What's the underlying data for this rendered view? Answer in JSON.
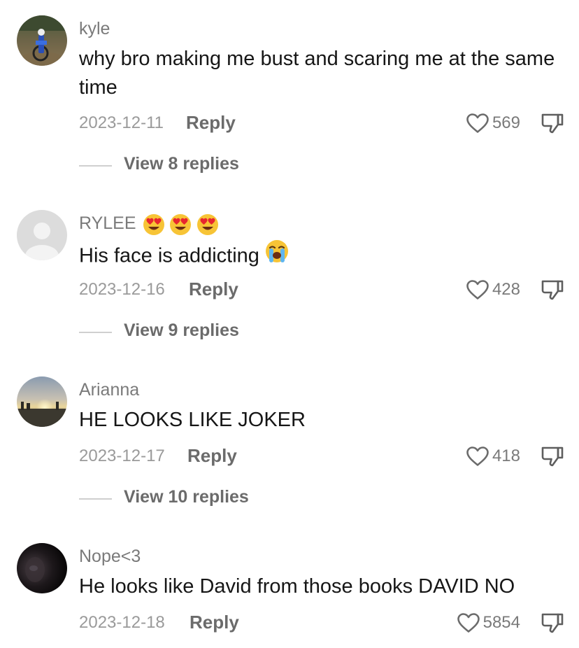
{
  "comments": [
    {
      "username": "kyle",
      "text": "why bro making me bust and scaring me at the same time",
      "date": "2023-12-11",
      "reply_label": "Reply",
      "likes": "569",
      "view_replies": "View 8 replies"
    },
    {
      "username": "RYLEE",
      "username_emojis": [
        "heart-eyes-emoji",
        "heart-eyes-emoji",
        "heart-eyes-emoji"
      ],
      "text": "His face is addicting",
      "text_emoji": "loudly-crying-emoji",
      "date": "2023-12-16",
      "reply_label": "Reply",
      "likes": "428",
      "view_replies": "View 9 replies"
    },
    {
      "username": "Arianna",
      "text": "HE LOOKS LIKE JOKER",
      "date": "2023-12-17",
      "reply_label": "Reply",
      "likes": "418",
      "view_replies": "View 10 replies"
    },
    {
      "username": "Nope<3",
      "text": "He looks like David from those books DAVID NO",
      "date": "2023-12-18",
      "reply_label": "Reply",
      "likes": "5854"
    }
  ],
  "icons": {
    "like": "heart-outline-icon",
    "dislike": "thumbs-down-icon"
  },
  "colors": {
    "username": "#7a7a7a",
    "text": "#161616",
    "meta": "#9a9a9a",
    "action": "#6b6b6b"
  }
}
